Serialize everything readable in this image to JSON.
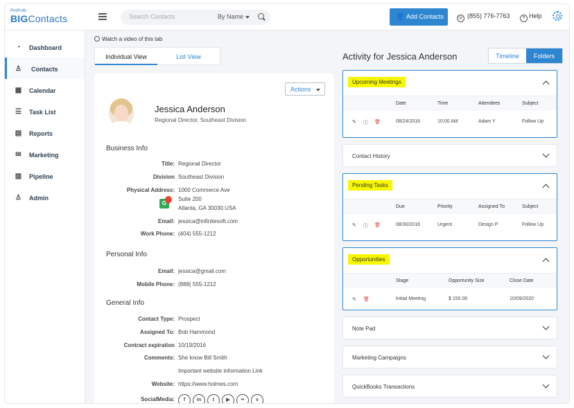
{
  "header": {
    "logo_small": "ProProfs",
    "logo_big_bold": "BIG",
    "logo_big_rest": "Contacts",
    "search_placeholder": "Search Contacts",
    "search_by": "By Name",
    "add_button": "Add Contacts",
    "phone": "(855) 776-7763",
    "help": "Help"
  },
  "sidebar": {
    "items": [
      {
        "label": "Dashboard",
        "icon": "dashboard-icon",
        "glyph": "◔"
      },
      {
        "label": "Contacts",
        "icon": "user-icon",
        "glyph": "♙"
      },
      {
        "label": "Calendar",
        "icon": "calendar-icon",
        "glyph": "▦"
      },
      {
        "label": "Task List",
        "icon": "checklist-icon",
        "glyph": "☰"
      },
      {
        "label": "Reports",
        "icon": "report-icon",
        "glyph": "▤"
      },
      {
        "label": "Marketing",
        "icon": "mail-icon",
        "glyph": "✉"
      },
      {
        "label": "Pipeline",
        "icon": "pipeline-icon",
        "glyph": "▥"
      },
      {
        "label": "Admin",
        "icon": "admin-icon",
        "glyph": "♙"
      }
    ]
  },
  "video_link": "Watch a video of this tab",
  "tabs": [
    "Individual View",
    "List View"
  ],
  "contact": {
    "actions": "Actions",
    "name": "Jessica Anderson",
    "role": "Regional Director, Southeast Division",
    "business_title": "Business Info",
    "business": [
      {
        "label": "Title:",
        "value": "Regional Director"
      },
      {
        "label": "Division",
        "value": "Southeast Division"
      },
      {
        "label": "Physical Address:",
        "value": "1000 Commerce Ave"
      },
      {
        "label": "",
        "value": "Suite 200"
      },
      {
        "label": "",
        "value": "Atlanta, GA 30030 USA"
      },
      {
        "label": "Email:",
        "value": "jessica@infinitesoft.com"
      },
      {
        "label": "Work Phone:",
        "value": "(404) 555-1212"
      }
    ],
    "personal_title": "Personal Info",
    "personal": [
      {
        "label": "Email:",
        "value": "jessica@gmail.com"
      },
      {
        "label": "Mobile Phone:",
        "value": "(888( 555-1212"
      }
    ],
    "general_title": "General Info",
    "general": [
      {
        "label": "Contact Type:",
        "value": "Prospect"
      },
      {
        "label": "Assigned To:",
        "value": "Bob Hammond"
      },
      {
        "label": "Contract expiration",
        "value": "10/19/2016"
      },
      {
        "label": "Comments:",
        "value": "She know Bill Smith"
      },
      {
        "label": "",
        "value": "Important website information Link"
      },
      {
        "label": "Website:",
        "value": "https://www.holmes.com"
      },
      {
        "label": "SocialMedia:",
        "value": ""
      }
    ],
    "social": [
      {
        "name": "facebook-icon",
        "glyph": "f"
      },
      {
        "name": "linkedin-icon",
        "glyph": "in"
      },
      {
        "name": "twitter-icon",
        "glyph": "t"
      },
      {
        "name": "youtube-icon",
        "glyph": "▶"
      },
      {
        "name": "flickr-icon",
        "glyph": "••"
      },
      {
        "name": "vimeo-icon",
        "glyph": "v"
      }
    ]
  },
  "activity": {
    "title": "Activity for Jessica Anderson",
    "view_timeline": "Timeline",
    "view_folders": "Folders",
    "meetings": {
      "title": "Upcoming Meetings",
      "headers": [
        "Date",
        "Time",
        "Attendees",
        "Subject"
      ],
      "row": [
        "08/24/2016",
        "10:00 AM",
        "Adam Y",
        "Follow Up"
      ]
    },
    "contact_history": "Contact History",
    "tasks": {
      "title": "Pending Tasks",
      "headers": [
        "Due",
        "Priority",
        "Assigned To",
        "Subject"
      ],
      "row": [
        "08/30/2016",
        "Urgent",
        "Design P",
        "Follow Up"
      ]
    },
    "opportunities": {
      "title": "Opportunities",
      "headers": [
        "Stage",
        "Opportunity Size",
        "Close Date"
      ],
      "row": [
        "Initial Meeting",
        "$ 150.00",
        "10/09/2020"
      ]
    },
    "collapsed": [
      "Note Pad",
      "Marketing Campaigns",
      "QuickBooks Transactions"
    ]
  },
  "colors": {
    "accent": "#2e86d1",
    "highlight": "#f7f700"
  }
}
